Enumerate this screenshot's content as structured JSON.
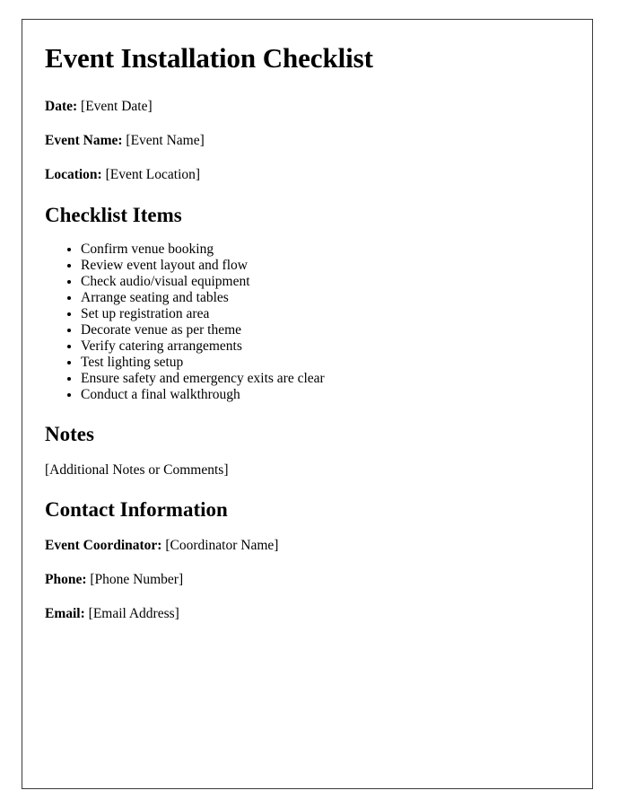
{
  "document": {
    "title": "Event Installation Checklist",
    "meta_fields": [
      {
        "label": "Date:",
        "value": "[Event Date]"
      },
      {
        "label": "Event Name:",
        "value": "[Event Name]"
      },
      {
        "label": "Location:",
        "value": "[Event Location]"
      }
    ],
    "checklist_section": {
      "heading": "Checklist Items",
      "items": [
        "Confirm venue booking",
        "Review event layout and flow",
        "Check audio/visual equipment",
        "Arrange seating and tables",
        "Set up registration area",
        "Decorate venue as per theme",
        "Verify catering arrangements",
        "Test lighting setup",
        "Ensure safety and emergency exits are clear",
        "Conduct a final walkthrough"
      ]
    },
    "notes_section": {
      "heading": "Notes",
      "body": "[Additional Notes or Comments]"
    },
    "contact_section": {
      "heading": "Contact Information",
      "fields": [
        {
          "label": "Event Coordinator:",
          "value": "[Coordinator Name]"
        },
        {
          "label": "Phone:",
          "value": "[Phone Number]"
        },
        {
          "label": "Email:",
          "value": "[Email Address]"
        }
      ]
    },
    "colors": {
      "text": "#000000",
      "page_background": "#ffffff",
      "border": "#3a3a3a"
    }
  }
}
